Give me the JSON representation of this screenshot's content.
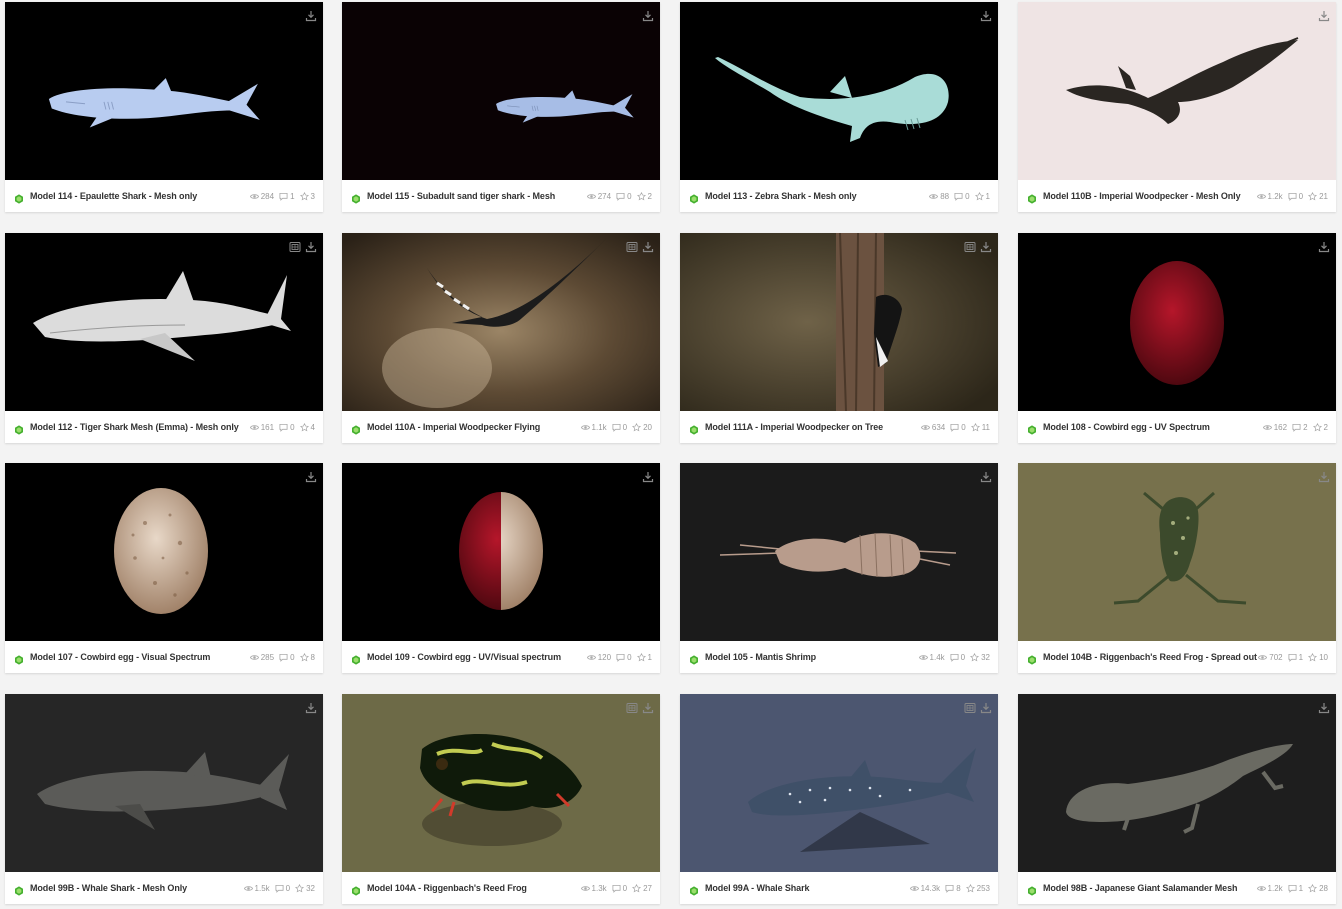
{
  "colors": {
    "badge": "#45b02f",
    "title": "#333333",
    "stat": "#999999"
  },
  "icons": {
    "download": "download-icon",
    "vr": "vr-headset-icon",
    "views": "eye-icon",
    "comments": "comment-icon",
    "likes": "star-icon",
    "badge": "staff-pick-badge-icon"
  },
  "models": [
    {
      "title": "Model 114 - Epaulette Shark - Mesh only",
      "views": "284",
      "comments": "1",
      "likes": "3",
      "bg": "#000000",
      "vr": false,
      "dl": true,
      "scene": "shark-blue"
    },
    {
      "title": "Model 115 - Subadult sand tiger shark - Mesh",
      "views": "274",
      "comments": "0",
      "likes": "2",
      "bg": "#0a0204",
      "vr": false,
      "dl": true,
      "scene": "shark-blue2"
    },
    {
      "title": "Model 113 - Zebra Shark - Mesh only",
      "views": "88",
      "comments": "0",
      "likes": "1",
      "bg": "#000000",
      "vr": false,
      "dl": true,
      "scene": "shark-mint"
    },
    {
      "title": "Model 110B - Imperial Woodpecker - Mesh Only",
      "views": "1.2k",
      "comments": "0",
      "likes": "21",
      "bg": "#efe4e4",
      "vr": false,
      "dl": true,
      "scene": "bird-dark"
    },
    {
      "title": "Model 112 - Tiger Shark Mesh (Emma) - Mesh only",
      "views": "161",
      "comments": "0",
      "likes": "4",
      "bg": "#000000",
      "vr": true,
      "dl": true,
      "scene": "shark-white"
    },
    {
      "title": "Model 110A - Imperial Woodpecker Flying",
      "views": "1.1k",
      "comments": "0",
      "likes": "20",
      "bg": "#4a3a2a",
      "vr": true,
      "dl": true,
      "scene": "bird-forest"
    },
    {
      "title": "Model 111A - Imperial Woodpecker on Tree",
      "views": "634",
      "comments": "0",
      "likes": "11",
      "bg": "#3b3022",
      "vr": true,
      "dl": true,
      "scene": "bird-tree"
    },
    {
      "title": "Model 108 - Cowbird egg - UV Spectrum",
      "views": "162",
      "comments": "2",
      "likes": "2",
      "bg": "#000000",
      "vr": false,
      "dl": true,
      "scene": "egg-red"
    },
    {
      "title": "Model 107 - Cowbird egg - Visual Spectrum",
      "views": "285",
      "comments": "0",
      "likes": "8",
      "bg": "#000000",
      "vr": false,
      "dl": true,
      "scene": "egg-speckle"
    },
    {
      "title": "Model 109 - Cowbird egg - UV/Visual spectrum",
      "views": "120",
      "comments": "0",
      "likes": "1",
      "bg": "#000000",
      "vr": false,
      "dl": true,
      "scene": "egg-half"
    },
    {
      "title": "Model 105 - Mantis Shrimp",
      "views": "1.4k",
      "comments": "0",
      "likes": "32",
      "bg": "#1b1b1b",
      "vr": false,
      "dl": true,
      "scene": "shrimp"
    },
    {
      "title": "Model 104B - Riggenbach's Reed Frog - Spread out",
      "views": "702",
      "comments": "1",
      "likes": "10",
      "bg": "#77714c",
      "vr": false,
      "dl": true,
      "scene": "frog-spread"
    },
    {
      "title": "Model 99B - Whale Shark - Mesh Only",
      "views": "1.5k",
      "comments": "0",
      "likes": "32",
      "bg": "#262626",
      "vr": false,
      "dl": true,
      "scene": "whale-gray"
    },
    {
      "title": "Model 104A - Riggenbach's Reed Frog",
      "views": "1.3k",
      "comments": "0",
      "likes": "27",
      "bg": "#6d6a47",
      "vr": true,
      "dl": true,
      "scene": "frog"
    },
    {
      "title": "Model 99A - Whale Shark",
      "views": "14.3k",
      "comments": "8",
      "likes": "253",
      "bg": "#4c5670",
      "vr": true,
      "dl": true,
      "scene": "whale-spotted"
    },
    {
      "title": "Model 98B - Japanese Giant Salamander Mesh",
      "views": "1.2k",
      "comments": "1",
      "likes": "28",
      "bg": "#1e1e1e",
      "vr": false,
      "dl": true,
      "scene": "salamander"
    }
  ]
}
